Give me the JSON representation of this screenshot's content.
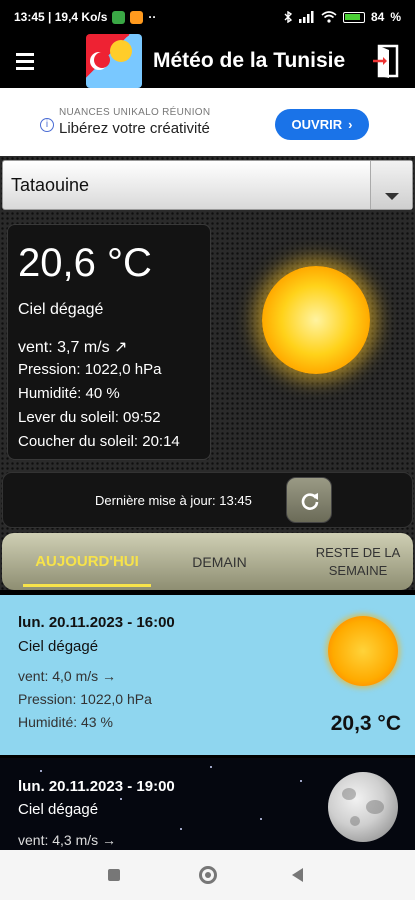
{
  "status_bar": {
    "left_text": "13:45 | 19,4 Ko/s",
    "battery": "84"
  },
  "app_bar": {
    "title": "Météo de la Tunisie"
  },
  "ad": {
    "sponsor": "NUANCES UNIKALO RÉUNION",
    "headline": "Libérez votre créativité",
    "button_label": "OUVRIR"
  },
  "city_select": {
    "selected": "Tataouine"
  },
  "current": {
    "temperature": "20,6 °C",
    "condition": "Ciel dégagé",
    "wind": "vent: 3,7 m/s ↗",
    "pressure": "Pression: 1022,0 hPa",
    "humidity": "Humidité: 40 %",
    "sunrise": "Lever du soleil: 09:52",
    "sunset": "Coucher du soleil: 20:14"
  },
  "update": {
    "text": "Dernière mise à jour: 13:45"
  },
  "tabs": [
    {
      "label": "AUJOURD'HUI"
    },
    {
      "label": "DEMAIN"
    },
    {
      "label": "RESTE DE LA SEMAINE"
    }
  ],
  "forecast": [
    {
      "datetime": "lun. 20.11.2023 - 16:00",
      "condition": "Ciel dégagé",
      "wind": "vent: 4,0 m/s →",
      "pressure": "Pression: 1022,0 hPa",
      "humidity": "Humidité: 43 %",
      "temperature": "20,3 °C"
    },
    {
      "datetime": "lun. 20.11.2023 - 19:00",
      "condition": "Ciel dégagé",
      "wind": "vent: 4,3 m/s →"
    }
  ],
  "colors": {
    "accent_tab": "#f7e34a",
    "day_card": "#8fd6ef",
    "ad_button": "#1a73e8"
  }
}
